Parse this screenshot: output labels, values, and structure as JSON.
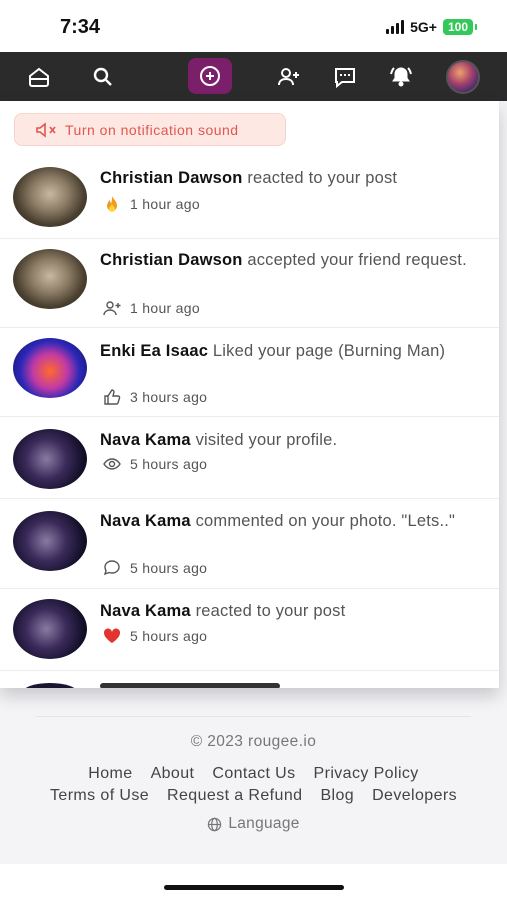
{
  "status_bar": {
    "time": "7:34",
    "network": "5G+",
    "battery": "100"
  },
  "nav": {
    "icons": [
      "home-icon",
      "search-icon",
      "create-icon",
      "friend-requests-icon",
      "messages-icon",
      "notifications-icon",
      "profile-avatar"
    ]
  },
  "notification_sound": {
    "label": "Turn on notification sound"
  },
  "notifications": [
    {
      "name": "Christian Dawson",
      "action": " reacted to your post",
      "time": "1 hour ago",
      "icon": "fire-icon"
    },
    {
      "name": "Christian Dawson",
      "action": " accepted your friend request.",
      "time": "1 hour ago",
      "icon": "add-friend-icon"
    },
    {
      "name": "Enki Ea Isaac",
      "action": " Liked your page (Burning Man)",
      "time": "3 hours ago",
      "icon": "thumbs-up-icon"
    },
    {
      "name": "Nava Kama",
      "action": " visited your profile.",
      "time": "5 hours ago",
      "icon": "eye-icon"
    },
    {
      "name": "Nava Kama",
      "action": " commented on your photo. \"Lets..\"",
      "time": "5 hours ago",
      "icon": "comment-icon"
    },
    {
      "name": "Nava Kama",
      "action": " reacted to your post",
      "time": "5 hours ago",
      "icon": "heart-icon"
    }
  ],
  "footer": {
    "copyright": "© 2023 rougee.io",
    "links_row1": [
      "Home",
      "About",
      "Contact Us",
      "Privacy Policy"
    ],
    "links_row2": [
      "Terms of Use",
      "Request a Refund",
      "Blog",
      "Developers"
    ],
    "language": "Language"
  },
  "colors": {
    "nav_bg": "#2b2b2b",
    "create_accent": "#7b1f6a",
    "sound_pill_text": "#e0574d",
    "battery": "#34c759"
  }
}
